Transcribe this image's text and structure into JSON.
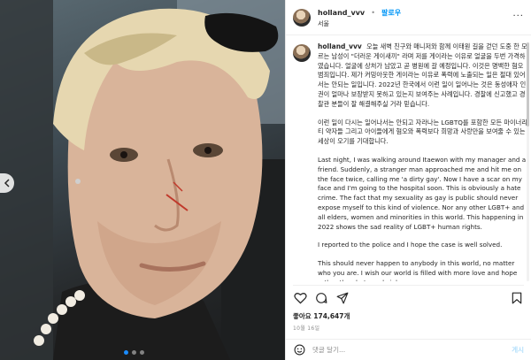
{
  "post": {
    "username": "holland_vvv",
    "follow_label": "팔로우",
    "separator": "•",
    "location": "서울",
    "more_label": "···"
  },
  "caption": {
    "username": "holland_vvv",
    "korean_paragraph_1": "오늘 새벽 친구와 매니저와 함께 이태원 길을 걷던 도중 한 모르는 남성이 \"더러운 게이새끼\" 라며 저를 게이라는 이유로 얼굴을 두번 가격하였습니다. 얼굴에 상처가 남았고 곧 병원에 갈 예정입니다. 이것은 명백한 혐오범죄입니다. 제가 커밍아웃한 게이라는 이유로 폭력에 노출되는 일은 절대 있어서는 안되는 일입니다. 2022년 한국에서 이런 일이 일어나는 것은 동성애자 인권이 얼마나 보장받지 못하고 있는지 보여주는 사례입니다. 경찰에 신고했고 경찰관 분들이 잘 해결해주실 거라 믿습니다.",
    "korean_paragraph_2": "이런 일이 다시는 일어나서는 안되고 자라나는 LGBTQ를 포함한 모든 마이너리티 약자들 그리고 아이들에게 혐오와 폭력보다 희망과 사랑만을 보여줄 수 있는 세상이 오기를 기대합니다.",
    "english_paragraph_1": "Last night, I was walking around Itaewon with my manager and a friend. Suddenly, a stranger man approached me and hit me on the face twice, calling me 'a dirty gay'. Now I have a scar on my face and I'm going to the hospital soon. This is obviously a hate crime. The fact that my sexuality as gay is public should never expose myself to this kind of violence. Nor any other LGBT+ and all elders, women and minorities in this world. This happening in 2022 shows the sad reality of LGBT+ human rights.",
    "english_paragraph_2": "I reported to the police and I hope the case is well solved.",
    "english_paragraph_3": "This should never happen to anybody in this world, no matter who you are. I wish our world is filled with more love and hope rather than hate and violence."
  },
  "stats": {
    "likes": "좋아요 174,647개",
    "date": "10월 16일"
  },
  "comment": {
    "placeholder": "댓글 달기...",
    "post_label": "게시"
  },
  "icons": {
    "like": "heart-icon",
    "comment": "comment-icon",
    "share": "share-icon",
    "save": "bookmark-icon",
    "emoji": "emoji-icon",
    "prev": "chevron-left-icon"
  },
  "colors": {
    "link": "#0095f6",
    "text": "#262626",
    "muted": "#8e8e8e",
    "active_dot": "#1a8cff"
  }
}
